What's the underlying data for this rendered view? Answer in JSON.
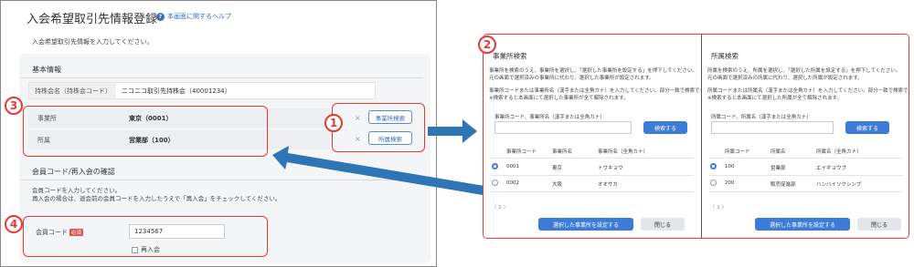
{
  "main": {
    "title": "入会希望取引先情報登録",
    "help_link": "本画面に関するヘルプ",
    "description": "入会希望取引先情報を入力してください。",
    "basic_info": {
      "heading": "基本情報",
      "member_name_label": "持株会名（持株会コード）",
      "member_name_value": "ニコニコ取引先持株会（40001234）",
      "office_label": "事業所",
      "office_value": "東京（0001）",
      "dept_label": "所属",
      "dept_value": "営業部（100）",
      "clear_symbol": "×",
      "office_search_button": "事業所検索",
      "dept_search_button": "所属検索"
    },
    "member_code_section": {
      "heading": "会員コード/再入会の確認",
      "instruction_1": "会員コードを入力してください。",
      "instruction_2": "再入会の場合は、退会前の会員コードを入力したうえで「再入会」をチェックしてください。",
      "code_label": "会員コード",
      "required_badge": "必須",
      "code_value": "1234567",
      "rejoin_label": "再入会"
    }
  },
  "badges": {
    "b1": "1",
    "b2": "2",
    "b3": "3",
    "b4": "4"
  },
  "office_panel": {
    "title": "事業所検索",
    "desc_1": "事業所を検索のうえ、事業所を選択し、「選択した事業所を設定する」を押下してください。",
    "desc_2": "元の画面で選択済みの事業所に代わり、選択した事業所が設定されます。",
    "desc_3": "事業所コードまたは事業所名（漢字または全角カナ）を入力してください。部分一致で検索できます。",
    "desc_4": "※検索すると本画面にて選択した事業所が全て解除されます。",
    "input_label": "事業所コード、事業所名（漢字または全角カナ）",
    "search_button": "検索する",
    "headers": [
      "事業所コード",
      "事業所名",
      "事業所名（全角カナ）"
    ],
    "rows": [
      {
        "code": "0001",
        "name": "東京",
        "kana": "トウキョウ",
        "selected": true
      },
      {
        "code": "0002",
        "name": "大阪",
        "kana": "オオサカ",
        "selected": false
      }
    ],
    "pager": "〈  1  〉",
    "set_button": "選択した事業所を設定する",
    "close_button": "閉じる"
  },
  "dept_panel": {
    "title": "所属検索",
    "desc_1": "所属を検索のうえ、所属を選択し、「選択した所属を設定する」を押下してください。",
    "desc_2": "元の画面で選択済みの所属に代わり、選択した所属が設定されます。",
    "desc_3": "所属コードまたは所属名（漢字または全角カナ）を入力してください。部分一致で検索できます。",
    "desc_4": "※検索すると本画面にて選択した所属が全て解除されます。",
    "input_label": "所属コード、所属名（漢字または全角カナ）",
    "search_button": "検索する",
    "headers": [
      "所属コード",
      "所属名",
      "所属名（全角カナ）"
    ],
    "rows": [
      {
        "code": "100",
        "name": "営業部",
        "kana": "エイギョウブ",
        "selected": true
      },
      {
        "code": "200",
        "name": "販売促進部",
        "kana": "ハンバイソクシンブ",
        "selected": false
      }
    ],
    "pager": "〈  1  〉",
    "set_button": "選択した事業所を設定する",
    "close_button": "閉じる"
  },
  "colors": {
    "accent": "#3d7bd9",
    "annotation": "#e53935",
    "arrow": "#2e75b6"
  }
}
